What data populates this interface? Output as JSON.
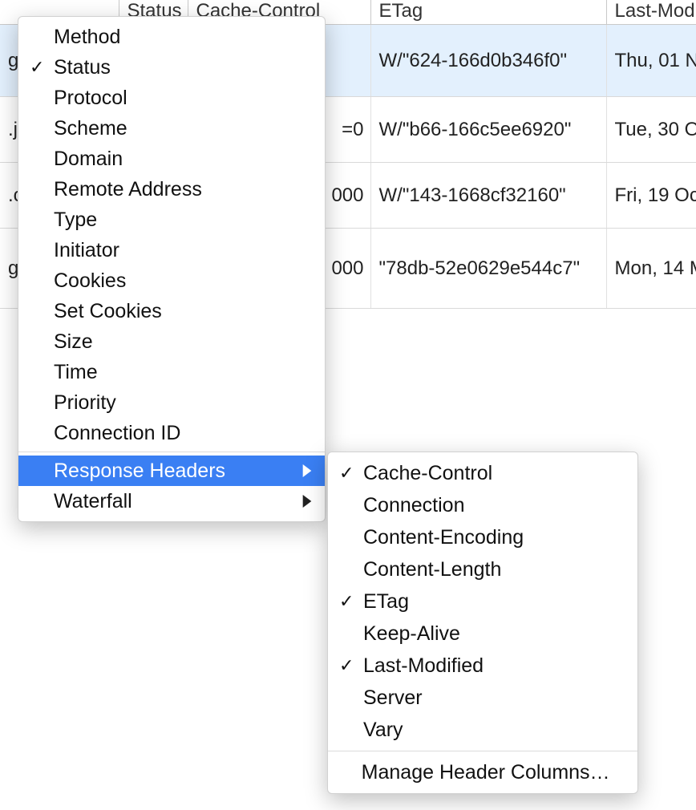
{
  "columns": {
    "c0": "",
    "c1": "Status",
    "c2": "Cache-Control",
    "c3": "ETag",
    "c4": "Last-Mod"
  },
  "rows": [
    {
      "name": "g",
      "status": "",
      "cache": "",
      "etag": "W/\"624-166d0b346f0\"",
      "lastmod": "Thu, 01 N",
      "selected": true
    },
    {
      "name": ".js",
      "status": "",
      "cache": "=0",
      "etag": "W/\"b66-166c5ee6920\"",
      "lastmod": "Tue, 30 O",
      "selected": false
    },
    {
      "name": ".c",
      "status": "",
      "cache": "000",
      "etag": "W/\"143-1668cf32160\"",
      "lastmod": "Fri, 19 Oc",
      "selected": false
    },
    {
      "name": "g\nrg",
      "status": "",
      "cache": "000",
      "etag": "\"78db-52e0629e544c7\"",
      "lastmod": "Mon, 14 M",
      "selected": false
    }
  ],
  "menu": {
    "items": [
      {
        "label": "Method",
        "checked": false,
        "submenu": false
      },
      {
        "label": "Status",
        "checked": true,
        "submenu": false
      },
      {
        "label": "Protocol",
        "checked": false,
        "submenu": false
      },
      {
        "label": "Scheme",
        "checked": false,
        "submenu": false
      },
      {
        "label": "Domain",
        "checked": false,
        "submenu": false
      },
      {
        "label": "Remote Address",
        "checked": false,
        "submenu": false
      },
      {
        "label": "Type",
        "checked": false,
        "submenu": false
      },
      {
        "label": "Initiator",
        "checked": false,
        "submenu": false
      },
      {
        "label": "Cookies",
        "checked": false,
        "submenu": false
      },
      {
        "label": "Set Cookies",
        "checked": false,
        "submenu": false
      },
      {
        "label": "Size",
        "checked": false,
        "submenu": false
      },
      {
        "label": "Time",
        "checked": false,
        "submenu": false
      },
      {
        "label": "Priority",
        "checked": false,
        "submenu": false
      },
      {
        "label": "Connection ID",
        "checked": false,
        "submenu": false
      },
      {
        "sep": true
      },
      {
        "label": "Response Headers",
        "checked": false,
        "submenu": true,
        "highlight": true
      },
      {
        "label": "Waterfall",
        "checked": false,
        "submenu": true
      }
    ]
  },
  "submenu": {
    "items": [
      {
        "label": "Cache-Control",
        "checked": true
      },
      {
        "label": "Connection",
        "checked": false
      },
      {
        "label": "Content-Encoding",
        "checked": false
      },
      {
        "label": "Content-Length",
        "checked": false
      },
      {
        "label": "ETag",
        "checked": true
      },
      {
        "label": "Keep-Alive",
        "checked": false
      },
      {
        "label": "Last-Modified",
        "checked": true
      },
      {
        "label": "Server",
        "checked": false
      },
      {
        "label": "Vary",
        "checked": false
      },
      {
        "sep": true
      },
      {
        "label": "Manage Header Columns…",
        "checked": false
      }
    ]
  }
}
